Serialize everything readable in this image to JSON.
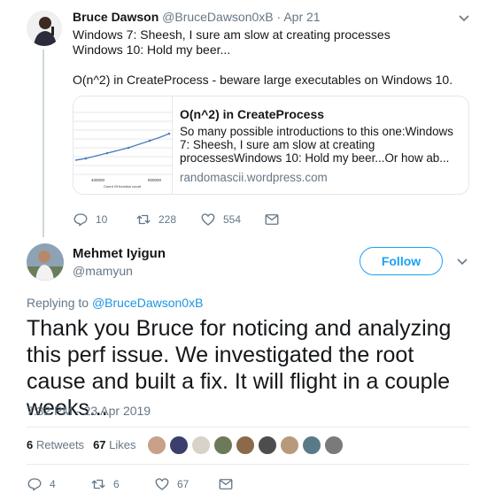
{
  "tweet1": {
    "author_name": "Bruce Dawson",
    "author_handle": "@BruceDawson0xB",
    "separator": "·",
    "date": "Apr 21",
    "text_lines": [
      "Windows 7: Sheesh, I sure am slow at creating processes",
      "Windows 10: Hold my beer...",
      "",
      "O(n^2) in CreateProcess - beware large executables on Windows 10."
    ],
    "card": {
      "title": "O(n^2) in CreateProcess",
      "description": "So many possible introductions to this one:Windows 7: Sheesh, I sure am slow at creating processesWindows 10: Hold my beer...Or how ab...",
      "domain": "randomascii.wordpress.com",
      "thumb_xticks": [
        "400000",
        "800000"
      ],
      "thumb_xlabel": "Count Of function count",
      "line_color": "#4a7ebb"
    },
    "actions": {
      "replies": "10",
      "retweets": "228",
      "likes": "554"
    }
  },
  "tweet2": {
    "author_name": "Mehmet Iyigun",
    "author_handle": "@mamyun",
    "follow_label": "Follow",
    "replying_prefix": "Replying to",
    "replying_to": "@BruceDawson0xB",
    "text": "Thank you Bruce for noticing and analyzing this perf issue. We investigated the root cause and built a fix. It will flight in a couple weeks...",
    "timestamp": "7:32 PM - 23 Apr 2019",
    "retweets_count": "6",
    "retweets_label": "Retweets",
    "likes_count": "67",
    "likes_label": "Likes",
    "liker_colors": [
      "#c9a08a",
      "#3a3f6b",
      "#d8d2c8",
      "#6d7a5a",
      "#8a6a4a",
      "#4d4d4d",
      "#b89a7a",
      "#5a7a8a",
      "#7a7a7a"
    ],
    "actions": {
      "replies": "4",
      "retweets": "6",
      "likes": "67"
    }
  },
  "colors": {
    "accent": "#1da1f2",
    "link": "#1b95e0",
    "muted": "#657786"
  }
}
